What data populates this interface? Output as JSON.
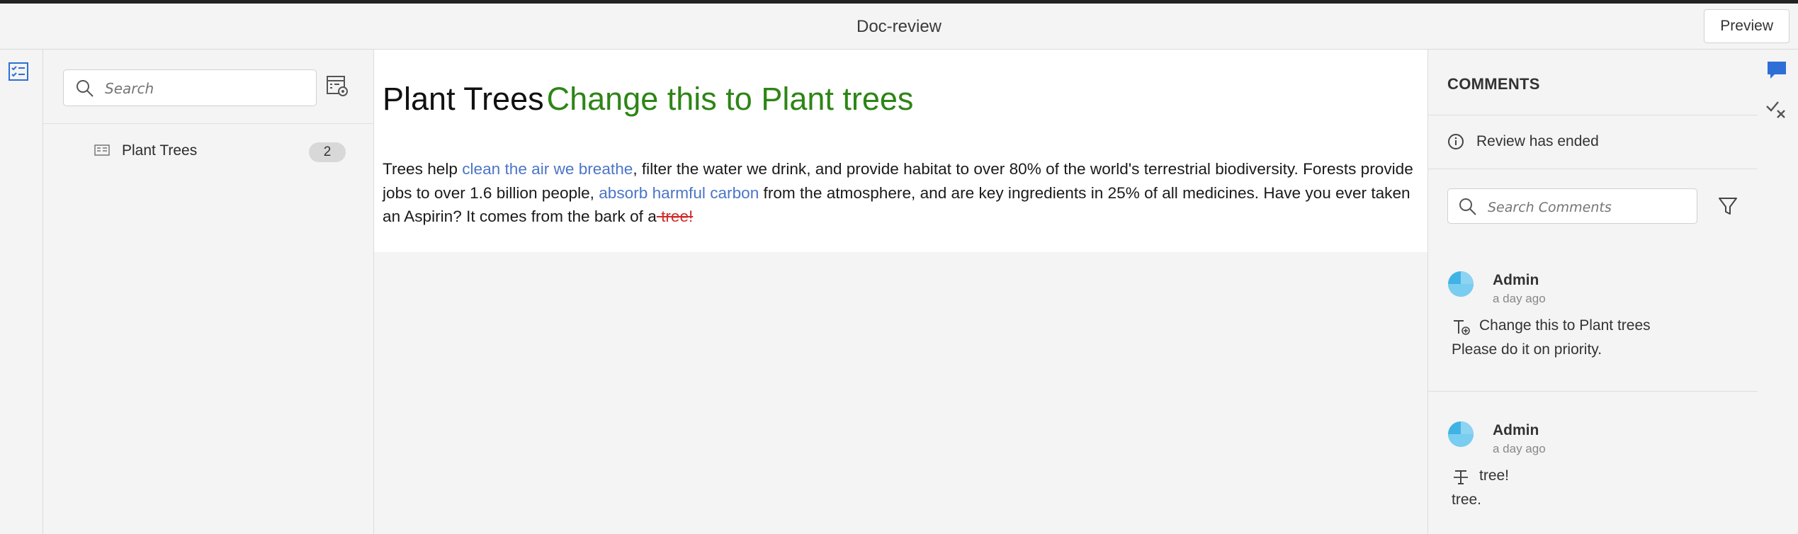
{
  "app": {
    "title": "Doc-review"
  },
  "header": {
    "preview_label": "Preview"
  },
  "outline": {
    "search_placeholder": "Search",
    "items": [
      {
        "label": "Plant Trees",
        "count": "2"
      }
    ]
  },
  "document": {
    "title": "Plant Trees",
    "title_insertion": "Change this to Plant trees",
    "paragraph": {
      "seg1": "Trees help ",
      "link1": "clean the air we breathe",
      "seg2": ", filter the water we drink, and provide habitat to over 80% of the world's terrestrial biodiversity. Forests provide jobs to over 1.6 billion people, ",
      "link2": "absorb harmful carbon",
      "seg3": " from the atmosphere, and are key ingredients in 25% of all medicines. Have you ever taken an Aspirin? It comes from the bark of a",
      "deleted": " tree!"
    }
  },
  "comments": {
    "title": "COMMENTS",
    "status": "Review has ended",
    "search_placeholder": "Search Comments",
    "items": [
      {
        "author": "Admin",
        "time": "a day ago",
        "type_icon": "insert-text-icon",
        "reference": "Change this to Plant trees",
        "note": "Please do it on priority."
      },
      {
        "author": "Admin",
        "time": "a day ago",
        "type_icon": "strikethrough-text-icon",
        "reference": "tree!",
        "note": "tree."
      }
    ]
  },
  "colors": {
    "accent": "#2d6fd6",
    "insertion": "#2d8516",
    "deletion": "#d12a2a",
    "link": "#4b75c8",
    "avatar": "#3fb3e6"
  }
}
